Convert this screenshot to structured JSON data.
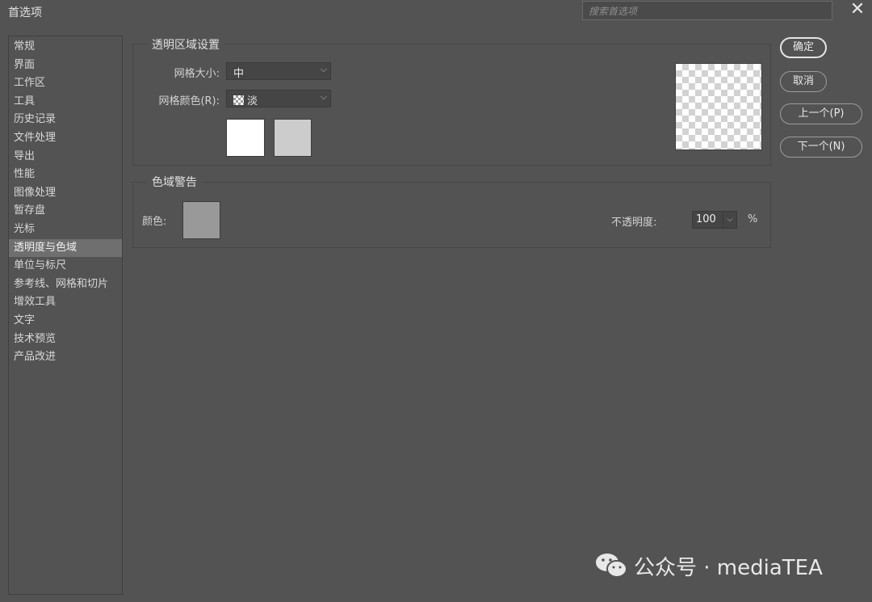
{
  "window": {
    "title": "首选项",
    "search_placeholder": "搜索首选项",
    "close_glyph": "✕"
  },
  "sidebar": {
    "selected_index": 11,
    "items": [
      {
        "label": "常规"
      },
      {
        "label": "界面"
      },
      {
        "label": "工作区"
      },
      {
        "label": "工具"
      },
      {
        "label": "历史记录"
      },
      {
        "label": "文件处理"
      },
      {
        "label": "导出"
      },
      {
        "label": "性能"
      },
      {
        "label": "图像处理"
      },
      {
        "label": "暂存盘"
      },
      {
        "label": "光标"
      },
      {
        "label": "透明度与色域"
      },
      {
        "label": "单位与标尺"
      },
      {
        "label": "参考线、网格和切片"
      },
      {
        "label": "增效工具"
      },
      {
        "label": "文字"
      },
      {
        "label": "技术预览"
      },
      {
        "label": "产品改进"
      }
    ]
  },
  "transparency": {
    "section_title": "透明区域设置",
    "grid_size_label": "网格大小:",
    "grid_size_value": "中",
    "grid_color_label": "网格颜色(R):",
    "grid_color_value": "淡",
    "color1": "#ffffff",
    "color2": "#cccccc"
  },
  "gamut": {
    "section_title": "色域警告",
    "color_label": "颜色:",
    "color_value": "#999999",
    "opacity_label": "不透明度:",
    "opacity_value": "100",
    "opacity_unit": "%"
  },
  "buttons": {
    "ok": "确定",
    "cancel": "取消",
    "prev": "上一个(P)",
    "next": "下一个(N)"
  },
  "watermark": {
    "text": "公众号 · mediaTEA"
  },
  "colors": {
    "background": "#535353",
    "selected_item": "#6f6f6f",
    "input_background": "#454545"
  }
}
